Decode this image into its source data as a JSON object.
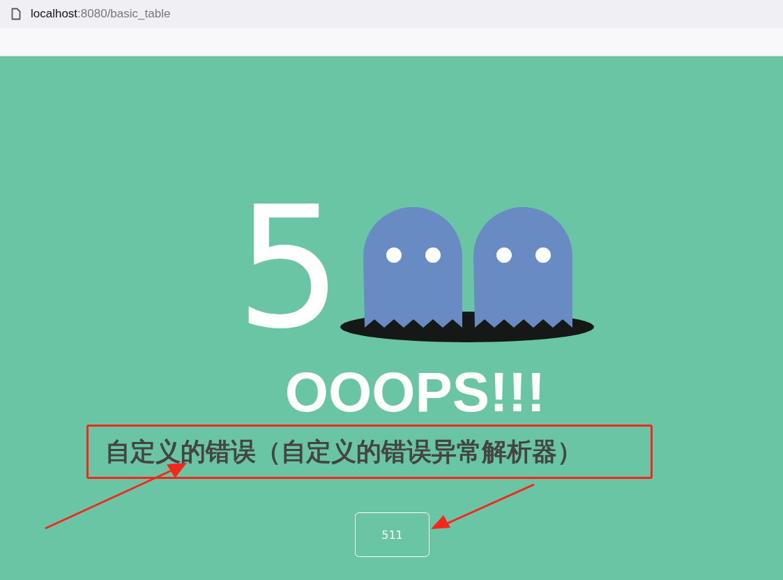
{
  "address_bar": {
    "host": "localhost",
    "path": ":8080/basic_table"
  },
  "error": {
    "code_digit": "5",
    "headline": "OOOPS!!!",
    "message": "自定义的错误（自定义的错误异常解析器）",
    "status_code": "511"
  }
}
